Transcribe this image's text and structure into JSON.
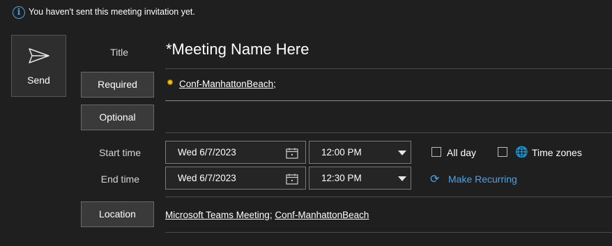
{
  "banner": {
    "message": "You haven't sent this meeting invitation yet."
  },
  "send": {
    "label": "Send"
  },
  "title": {
    "label": "Title",
    "value": "*Meeting Name Here"
  },
  "required": {
    "label": "Required",
    "attendee": "Conf-ManhattonBeach",
    "separator": ";"
  },
  "optional": {
    "label": "Optional"
  },
  "start": {
    "label": "Start time",
    "date": "Wed 6/7/2023",
    "time": "12:00 PM"
  },
  "end": {
    "label": "End time",
    "date": "Wed 6/7/2023",
    "time": "12:30 PM"
  },
  "all_day": {
    "label": "All day",
    "checked": false
  },
  "time_zones": {
    "label": "Time zones",
    "checked": false
  },
  "recurring": {
    "label": "Make Recurring"
  },
  "location": {
    "label": "Location",
    "value_1": "Microsoft Teams Meeting",
    "separator": ";",
    "value_2": "Conf-ManhattonBeach"
  },
  "colors": {
    "accent": "#4aa3e6",
    "presence": "#f2c200",
    "background": "#1f1f1f"
  }
}
